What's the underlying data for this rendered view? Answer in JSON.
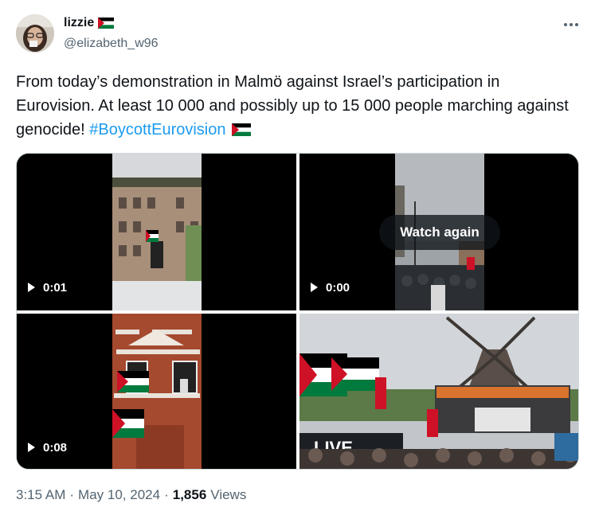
{
  "author": {
    "display_name": "lizzie",
    "handle": "@elizabeth_w96",
    "flag_icon": "palestine-flag-icon"
  },
  "tweet": {
    "text_main": "From today’s demonstration in Malmö against Israel’s participation in Eurovision. At least 10 000 and possibly up to 15 000 people marching against genocide! ",
    "hashtag": "#BoycottEurovision",
    "trailing_icon": "palestine-flag-icon"
  },
  "media": [
    {
      "kind": "video",
      "duration": "0:01"
    },
    {
      "kind": "video",
      "duration": "0:00",
      "overlay_label": "Watch again"
    },
    {
      "kind": "video",
      "duration": "0:08"
    },
    {
      "kind": "image",
      "stage_sign": "LIVE"
    }
  ],
  "meta": {
    "time": "3:15 AM",
    "date": "May 10, 2024",
    "views_count": "1,856",
    "views_label": "Views",
    "separator": "·"
  },
  "colors": {
    "accent": "#1d9bf0",
    "text": "#0f1419",
    "muted": "#536471",
    "flag_red": "#ce1126",
    "flag_green": "#007a3d",
    "flag_black": "#000000"
  }
}
